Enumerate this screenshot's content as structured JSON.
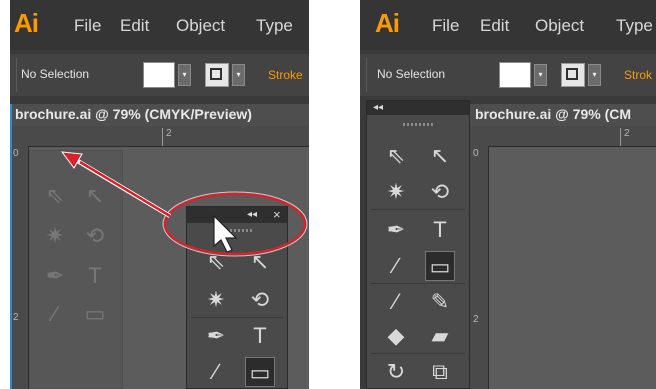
{
  "app": {
    "logo": "Ai",
    "brand_color": "#ff9a00"
  },
  "menu": [
    "File",
    "Edit",
    "Object",
    "Type"
  ],
  "control_bar": {
    "selection": "No Selection",
    "stroke_label": "Stroke",
    "stroke_label_clipped": "Strok"
  },
  "document": {
    "title": "brochure.ai @ 79% (CMYK/Preview)",
    "title_clipped": "brochure.ai @ 79% (CM"
  },
  "ruler": {
    "top_mark": "2",
    "left_mark_top": "0",
    "left_mark_mid": "2"
  },
  "tools_panel": {
    "collapse_glyph": "◂◂",
    "close_glyph": "×",
    "tools": [
      {
        "name": "selection-tool",
        "glyph": "⇖"
      },
      {
        "name": "direct-selection-tool",
        "glyph": "↖"
      },
      {
        "name": "magic-wand-tool",
        "glyph": "✷"
      },
      {
        "name": "lasso-tool",
        "glyph": "⟲"
      },
      {
        "name": "pen-tool",
        "glyph": "✒"
      },
      {
        "name": "type-tool",
        "glyph": "T"
      },
      {
        "name": "line-tool",
        "glyph": "∕"
      },
      {
        "name": "rectangle-tool",
        "glyph": "▭"
      },
      {
        "name": "paintbrush-tool",
        "glyph": "⁄"
      },
      {
        "name": "pencil-tool",
        "glyph": "✎"
      },
      {
        "name": "blob-brush-tool",
        "glyph": "◆"
      },
      {
        "name": "eraser-tool",
        "glyph": "▰"
      },
      {
        "name": "rotate-tool",
        "glyph": "↻"
      },
      {
        "name": "scale-tool",
        "glyph": "⧉"
      }
    ]
  },
  "annotation": {
    "callout_color": "#d6222a",
    "arrow_color": "#d6222a"
  }
}
